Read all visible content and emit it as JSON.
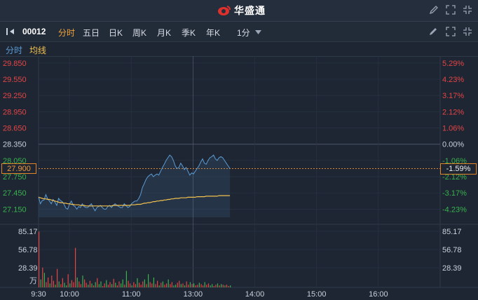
{
  "brand": {
    "name": "华盛通"
  },
  "toolbar": {
    "code": "00012",
    "tabs": [
      "分时",
      "五日",
      "日K",
      "周K",
      "月K",
      "季K",
      "年K"
    ],
    "active_tab": "分时",
    "interval": "1分"
  },
  "legend": {
    "intraday": "分时",
    "average": "均线"
  },
  "colors": {
    "up": "#e34545",
    "down": "#37b24d",
    "line": "#5b9bd5",
    "avg": "#f2c14e",
    "accent": "#f1a33b",
    "grid": "#2f3a49"
  },
  "icons": [
    "code-switch-icon",
    "chevron-down-icon",
    "pencil-icon",
    "fullscreen-icon",
    "shrink-icon"
  ],
  "current": {
    "price": "27.900",
    "change_pct": "-1.59%"
  },
  "chart_data": {
    "type": "line",
    "price_axis": [
      "29.850",
      "29.550",
      "29.250",
      "28.950",
      "28.650",
      "28.350",
      "28.050",
      "27.750",
      "27.450",
      "27.150"
    ],
    "pct_axis": [
      "5.29%",
      "4.23%",
      "3.17%",
      "2.12%",
      "1.06%",
      "0.00%",
      "-1.06%",
      "-2.12%",
      "-3.17%",
      "-4.23%"
    ],
    "pct_sign": [
      "up",
      "up",
      "up",
      "up",
      "up",
      "flat",
      "down",
      "down",
      "down",
      "down"
    ],
    "ylim": [
      27.0,
      29.9
    ],
    "prev_close": 28.35,
    "volume_axis": [
      "85.17",
      "56.78",
      "28.39"
    ],
    "volume_unit": "万",
    "volume_max": 85.17,
    "time_labels": [
      "9:30",
      "10:00",
      "11:00",
      "13:00",
      "14:00",
      "15:00",
      "16:00"
    ],
    "session_minutes": 390,
    "minute_of_label": [
      0,
      30,
      90,
      150,
      210,
      270,
      330,
      390
    ],
    "series": [
      {
        "name": "分时",
        "values": [
          27.38,
          27.25,
          27.31,
          27.32,
          27.42,
          27.34,
          27.3,
          27.25,
          27.33,
          27.28,
          27.22,
          27.35,
          27.31,
          27.29,
          27.24,
          27.17,
          27.15,
          27.25,
          27.3,
          27.22,
          27.2,
          27.15,
          27.2,
          27.18,
          27.25,
          27.2,
          27.18,
          27.18,
          27.22,
          27.25,
          27.18,
          27.12,
          27.18,
          27.2,
          27.22,
          27.18,
          27.15,
          27.15,
          27.2,
          27.22,
          27.18,
          27.22,
          27.25,
          27.22,
          27.2,
          27.18,
          27.18,
          27.25,
          27.22,
          27.18,
          27.2,
          27.25,
          27.28,
          27.3,
          27.3,
          27.35,
          27.42,
          27.55,
          27.62,
          27.7,
          27.75,
          27.78,
          27.8,
          27.75,
          27.78,
          27.8,
          27.78,
          27.85,
          27.92,
          27.98,
          28.05,
          28.1,
          28.15,
          28.12,
          28.05,
          27.95,
          27.9,
          27.92,
          28.0,
          27.95,
          27.88,
          27.92,
          27.85,
          27.78,
          27.82,
          27.8,
          27.85,
          27.9,
          27.95,
          28.02,
          28.08,
          28.0,
          27.98,
          28.05,
          28.1,
          28.12,
          28.15,
          28.08,
          28.05,
          28.1,
          28.12,
          28.1,
          28.05,
          28.0,
          27.95,
          27.9
        ]
      },
      {
        "name": "均线",
        "values": [
          27.37,
          27.36,
          27.35,
          27.34,
          27.34,
          27.33,
          27.33,
          27.32,
          27.31,
          27.3,
          27.29,
          27.28,
          27.27,
          27.27,
          27.26,
          27.26,
          27.25,
          27.25,
          27.24,
          27.24,
          27.23,
          27.23,
          27.23,
          27.22,
          27.22,
          27.22,
          27.21,
          27.21,
          27.21,
          27.21,
          27.21,
          27.21,
          27.21,
          27.21,
          27.21,
          27.21,
          27.21,
          27.21,
          27.21,
          27.21,
          27.21,
          27.22,
          27.22,
          27.22,
          27.22,
          27.22,
          27.22,
          27.22,
          27.22,
          27.22,
          27.22,
          27.23,
          27.23,
          27.23,
          27.24,
          27.24,
          27.24,
          27.25,
          27.26,
          27.26,
          27.27,
          27.27,
          27.28,
          27.29,
          27.29,
          27.3,
          27.3,
          27.31,
          27.31,
          27.32,
          27.32,
          27.33,
          27.33,
          27.34,
          27.34,
          27.35,
          27.35,
          27.35,
          27.36,
          27.36,
          27.36,
          27.36,
          27.37,
          27.37,
          27.37,
          27.37,
          27.37,
          27.38,
          27.38,
          27.38,
          27.38,
          27.38,
          27.39,
          27.39,
          27.39,
          27.39,
          27.39,
          27.39,
          27.39,
          27.4,
          27.4,
          27.4,
          27.4,
          27.4,
          27.4,
          27.4
        ]
      }
    ],
    "volume": [
      85,
      12,
      30,
      22,
      8,
      15,
      6,
      18,
      10,
      4,
      28,
      9,
      5,
      14,
      7,
      3,
      20,
      6,
      11,
      8,
      60,
      15,
      9,
      5,
      18,
      12,
      7,
      4,
      10,
      6,
      3,
      8,
      14,
      5,
      9,
      2,
      6,
      11,
      4,
      8,
      5,
      13,
      7,
      3,
      9,
      6,
      12,
      4,
      25,
      10,
      6,
      3,
      8,
      5,
      14,
      7,
      4,
      9,
      12,
      5,
      20,
      8,
      6,
      15,
      5,
      10,
      3,
      7,
      9,
      4,
      6,
      12,
      5,
      8,
      3,
      4,
      7,
      10,
      5,
      6,
      3,
      9,
      4,
      8,
      5,
      6,
      3,
      4,
      7,
      5,
      3,
      8,
      4,
      6,
      3,
      5,
      2,
      4,
      6,
      3,
      5,
      4,
      3,
      4,
      2,
      3
    ],
    "volume_dir": [
      "up",
      "down",
      "up",
      "down",
      "up",
      "up",
      "down",
      "up",
      "up",
      "down",
      "up",
      "down",
      "up",
      "up",
      "down",
      "down",
      "up",
      "down",
      "up",
      "up",
      "up",
      "down",
      "up",
      "up",
      "down",
      "up",
      "up",
      "down",
      "up",
      "down",
      "up",
      "down",
      "up",
      "down",
      "down",
      "up",
      "up",
      "down",
      "up",
      "up",
      "down",
      "up",
      "down",
      "up",
      "up",
      "down",
      "down",
      "up",
      "down",
      "up",
      "up",
      "down",
      "up",
      "up",
      "down",
      "up",
      "up",
      "up",
      "down",
      "up",
      "down",
      "up",
      "up",
      "down",
      "up",
      "up",
      "down",
      "up",
      "down",
      "up",
      "up",
      "down",
      "up",
      "up",
      "down",
      "down",
      "up",
      "up",
      "down",
      "up",
      "down",
      "up",
      "up",
      "down",
      "up",
      "down",
      "up",
      "up",
      "down",
      "up",
      "up",
      "down",
      "up",
      "up",
      "down",
      "down",
      "up",
      "up",
      "down",
      "up",
      "down",
      "up",
      "down",
      "up",
      "up",
      "down"
    ]
  }
}
